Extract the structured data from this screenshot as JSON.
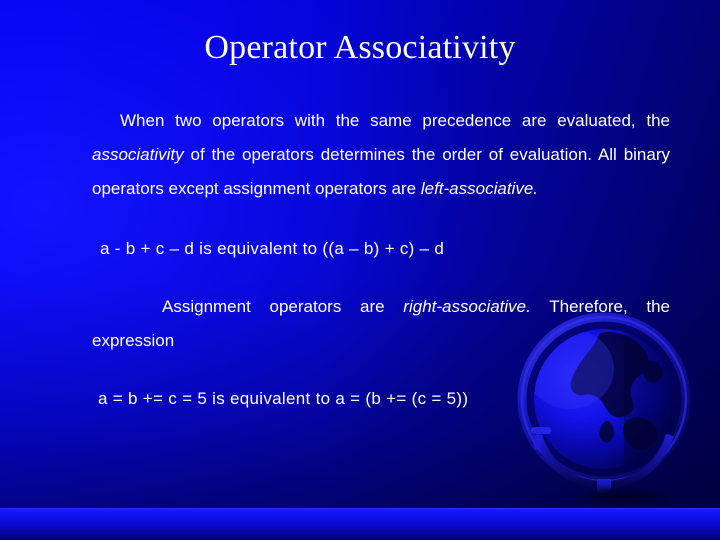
{
  "slide": {
    "title": "Operator Associativity",
    "background": {
      "gradient_from": "#0000ff",
      "gradient_to": "#000060",
      "band_color": "#1d1dff",
      "decoration": "globe-graphic"
    },
    "title_color": "#fffff0",
    "body_color": "#ffffff",
    "paragraphs": [
      {
        "id": "intro",
        "style": "justified",
        "runs": [
          {
            "text": "When two operators with the same precedence are evaluated, the ",
            "italic": false
          },
          {
            "text": "associativity",
            "italic": true
          },
          {
            "text": " of the operators determines the order of evaluation. All binary operators except assignment operators are ",
            "italic": false
          },
          {
            "text": "left-associative",
            "italic": true
          },
          {
            "text": ".",
            "italic": true
          }
        ]
      },
      {
        "id": "example-left",
        "style": "left",
        "runs": [
          {
            "text": "a - b + c – d is equivalent to  ((a – b) + c) – d",
            "italic": false
          }
        ]
      },
      {
        "id": "assignment",
        "style": "justified",
        "runs": [
          {
            "text": "Assignment operators are ",
            "italic": false
          },
          {
            "text": "right-associative",
            "italic": true
          },
          {
            "text": ".",
            "italic": true
          },
          {
            "text": " Therefore, the expression",
            "italic": false
          }
        ]
      },
      {
        "id": "example-right",
        "style": "left",
        "runs": [
          {
            "text": "a = b += c = 5 is equivalent to a = (b += (c = 5))",
            "italic": false
          }
        ]
      }
    ]
  }
}
